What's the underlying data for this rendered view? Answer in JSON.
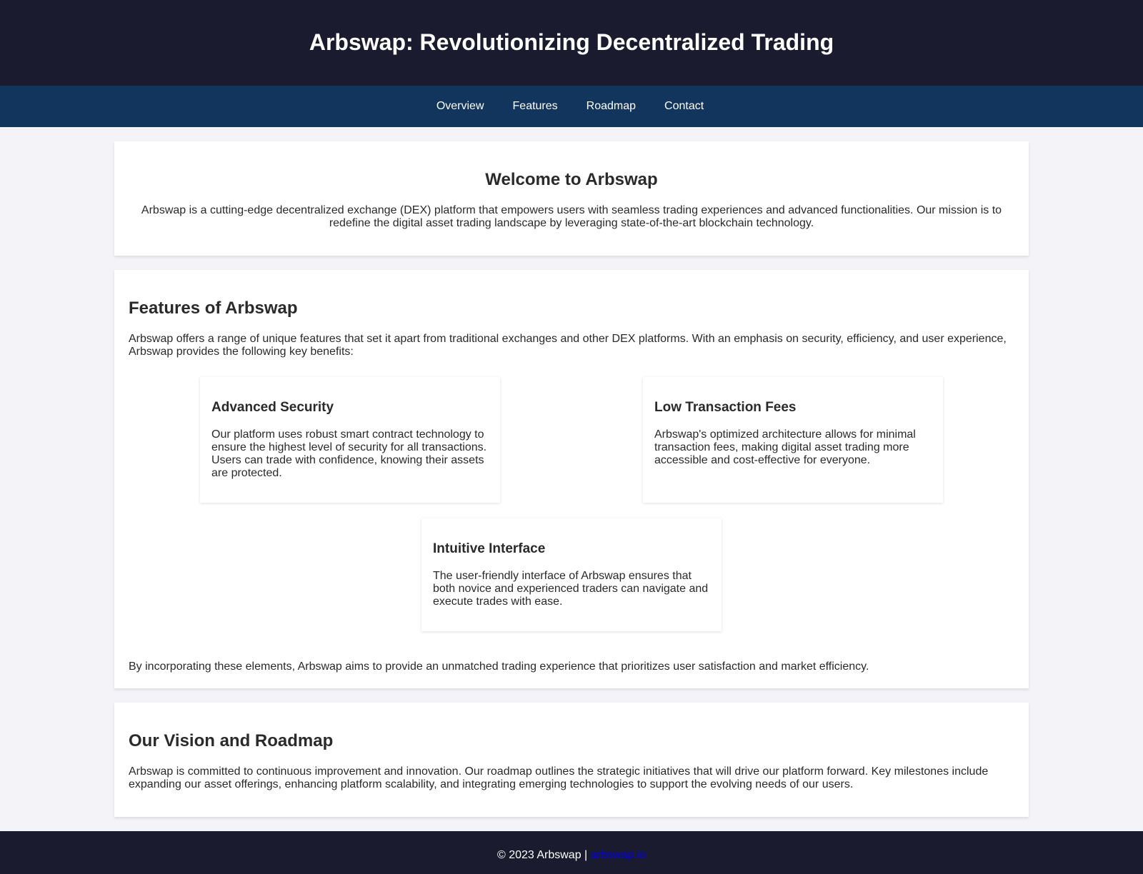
{
  "header": {
    "title": "Arbswap: Revolutionizing Decentralized Trading"
  },
  "nav": {
    "items": [
      "Overview",
      "Features",
      "Roadmap",
      "Contact"
    ]
  },
  "welcome": {
    "title": "Welcome to Arbswap",
    "text": "Arbswap is a cutting-edge decentralized exchange (DEX) platform that empowers users with seamless trading experiences and advanced functionalities. Our mission is to redefine the digital asset trading landscape by leveraging state-of-the-art blockchain technology."
  },
  "features": {
    "title": "Features of Arbswap",
    "intro": "Arbswap offers a range of unique features that set it apart from traditional exchanges and other DEX platforms. With an emphasis on security, efficiency, and user experience, Arbswap provides the following key benefits:",
    "items": [
      {
        "title": "Advanced Security",
        "text": "Our platform uses robust smart contract technology to ensure the highest level of security for all transactions. Users can trade with confidence, knowing their assets are protected."
      },
      {
        "title": "Low Transaction Fees",
        "text": "Arbswap's optimized architecture allows for minimal transaction fees, making digital asset trading more accessible and cost-effective for everyone."
      },
      {
        "title": "Intuitive Interface",
        "text": "The user-friendly interface of Arbswap ensures that both novice and experienced traders can navigate and execute trades with ease."
      }
    ],
    "closing": "By incorporating these elements, Arbswap aims to provide an unmatched trading experience that prioritizes user satisfaction and market efficiency."
  },
  "roadmap": {
    "title": "Our Vision and Roadmap",
    "text": "Arbswap is committed to continuous improvement and innovation. Our roadmap outlines the strategic initiatives that will drive our platform forward. Key milestones include expanding our asset offerings, enhancing platform scalability, and integrating emerging technologies to support the evolving needs of our users."
  },
  "footer": {
    "copyright": "© 2023 Arbswap |",
    "link_text": "arbswap.io"
  }
}
